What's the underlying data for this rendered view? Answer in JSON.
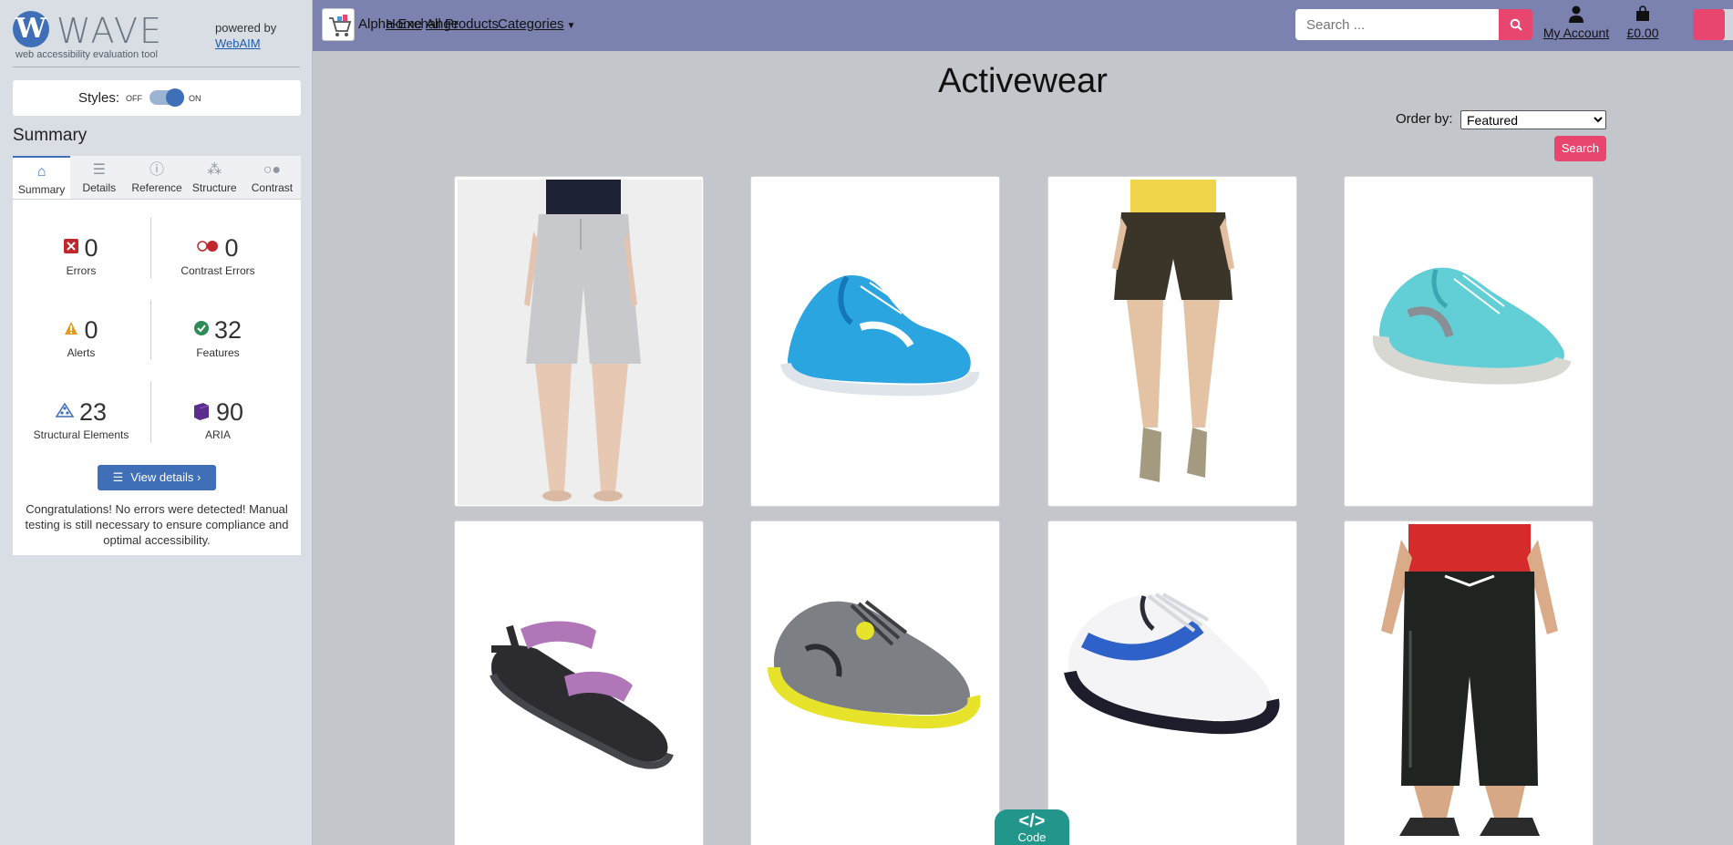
{
  "wave": {
    "logo_letter": "W",
    "logo_text": "WAVE",
    "tagline": "web accessibility evaluation tool",
    "powered_by": "powered by",
    "webaim": "WebAIM",
    "styles_label": "Styles:",
    "styles_off": "OFF",
    "styles_on": "ON",
    "summary_title": "Summary",
    "tabs": [
      {
        "label": "Summary",
        "icon": "home-icon"
      },
      {
        "label": "Details",
        "icon": "list-icon"
      },
      {
        "label": "Reference",
        "icon": "info-icon"
      },
      {
        "label": "Structure",
        "icon": "structure-icon"
      },
      {
        "label": "Contrast",
        "icon": "contrast-icon"
      }
    ],
    "stats": {
      "errors": {
        "value": "0",
        "label": "Errors",
        "color": "#c0272d"
      },
      "contrast_errors": {
        "value": "0",
        "label": "Contrast Errors",
        "color": "#c0272d"
      },
      "alerts": {
        "value": "0",
        "label": "Alerts",
        "color": "#e49a1c"
      },
      "features": {
        "value": "32",
        "label": "Features",
        "color": "#2e8b57"
      },
      "structural": {
        "value": "23",
        "label": "Structural Elements",
        "color": "#3f6fb6"
      },
      "aria": {
        "value": "90",
        "label": "ARIA",
        "color": "#5b2d8e"
      }
    },
    "view_details": "View details ›",
    "congrats": "Congratulations! No errors were detected! Manual testing is still necessary to ensure compliance and optimal accessibility."
  },
  "nav": {
    "brand": "Alpha-Exchange",
    "home": "Home",
    "all_products": "All Products",
    "categories": "Categories",
    "search_placeholder": "Search ...",
    "my_account": "My Account",
    "cart_total": "£0.00",
    "accent": "#e8456f",
    "bar_color": "#7b82b0"
  },
  "page": {
    "title": "Activewear",
    "order_label": "Order by:",
    "order_selected": "Featured",
    "search_button": "Search"
  },
  "products": [
    {
      "name": "grey-shorts",
      "kind": "shorts-woman"
    },
    {
      "name": "blue-running-shoe",
      "kind": "shoe-blue"
    },
    {
      "name": "brown-shorts",
      "kind": "shorts-brown"
    },
    {
      "name": "teal-running-shoe",
      "kind": "shoe-teal"
    },
    {
      "name": "purple-sandal",
      "kind": "sandal"
    },
    {
      "name": "grey-yellow-shoe",
      "kind": "shoe-grey"
    },
    {
      "name": "white-blue-shoe",
      "kind": "shoe-white"
    },
    {
      "name": "black-capri-pants",
      "kind": "capri-man"
    }
  ],
  "code_tab": {
    "symbol": "</>",
    "label": "Code"
  }
}
